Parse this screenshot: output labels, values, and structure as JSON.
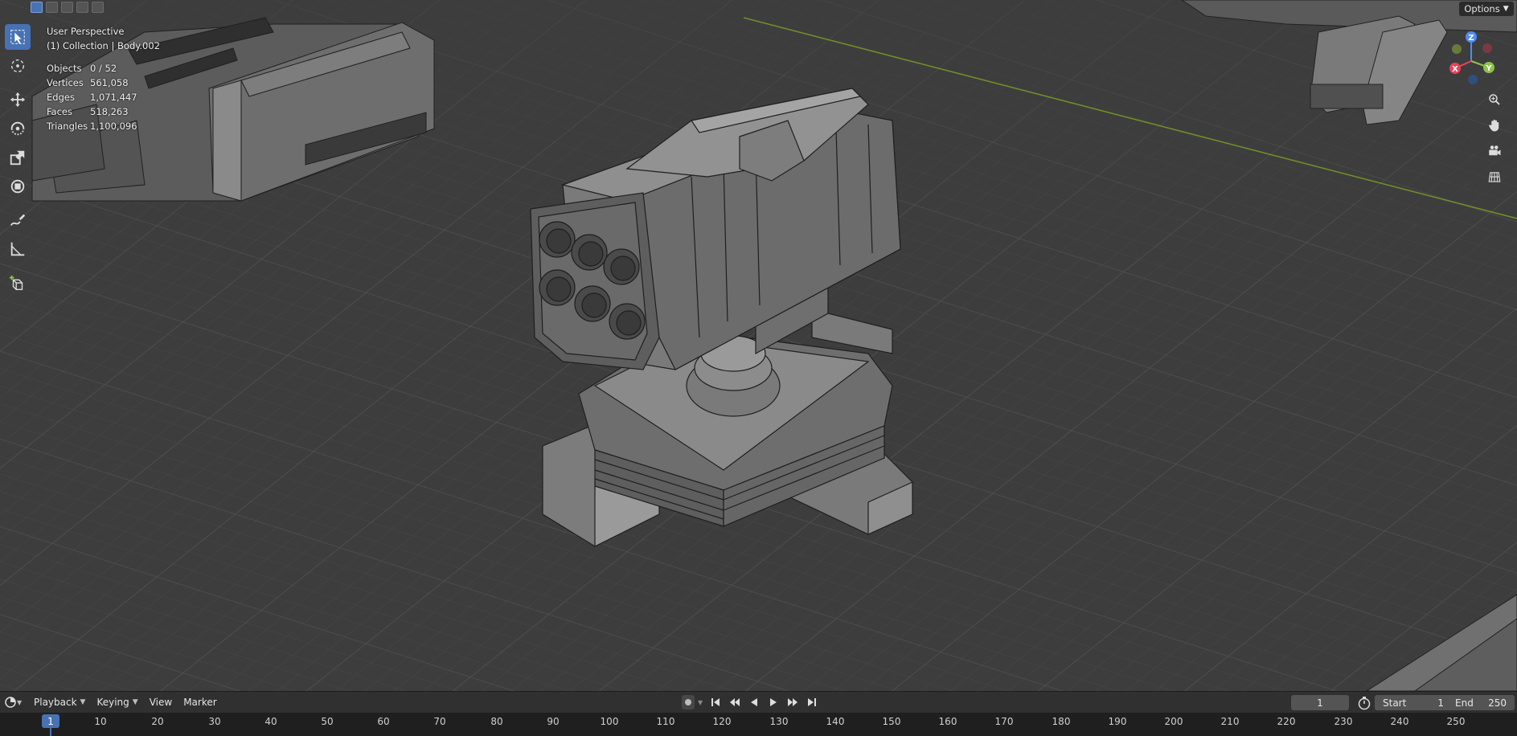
{
  "viewport": {
    "title": "User Perspective",
    "collection": "(1) Collection | Body.002",
    "stats": [
      {
        "label": "Objects",
        "value": "0 / 52"
      },
      {
        "label": "Vertices",
        "value": "561,058"
      },
      {
        "label": "Edges",
        "value": "1,071,447"
      },
      {
        "label": "Faces",
        "value": "518,263"
      },
      {
        "label": "Triangles",
        "value": "1,100,096"
      }
    ],
    "options_label": "Options",
    "gizmo": {
      "x": "X",
      "y": "Y",
      "z": "Z"
    },
    "colors": {
      "background": "#3d3d3d",
      "grid": "#4a4a4a",
      "x_axis": "#e8445a",
      "y_axis": "#8bc34a",
      "z_axis": "#4d8cf5",
      "accent": "#4772b3"
    }
  },
  "toolbar": {
    "tools": [
      "select-box-icon",
      "cursor-icon",
      "move-icon",
      "rotate-icon",
      "scale-icon",
      "transform-icon",
      "annotate-icon",
      "measure-icon",
      "add-cube-icon"
    ]
  },
  "timeline": {
    "menus": [
      "Playback",
      "Keying",
      "View",
      "Marker"
    ],
    "current_frame": "1",
    "start_label": "Start",
    "start_value": "1",
    "end_label": "End",
    "end_value": "250",
    "ruler_ticks": [
      "1",
      "10",
      "20",
      "30",
      "40",
      "50",
      "60",
      "70",
      "80",
      "90",
      "100",
      "110",
      "120",
      "130",
      "140",
      "150",
      "160",
      "170",
      "180",
      "190",
      "200",
      "210",
      "220",
      "230",
      "240",
      "250"
    ]
  }
}
